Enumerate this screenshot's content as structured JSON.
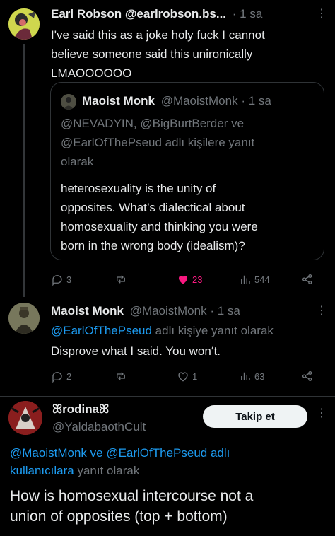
{
  "tweet1": {
    "display_name": "Earl Robson @earlrobson.bs...",
    "dot": "·",
    "time": "1 sa",
    "text_line1": "I've said this as a joke holy fuck I cannot",
    "text_line2": "believe someone said this unironically",
    "text_line3": "LMAOOOOOO",
    "quote": {
      "display_name": "Maoist Monk",
      "handle": "@MaoistMonk",
      "dot": "·",
      "time": "1 sa",
      "reply_line1": "@NEVADYIN, @BigBurtBerder ve",
      "reply_line2_handle": "@EarlOfThePseud",
      "reply_line2_rest": " adlı kişilere yanıt",
      "reply_line3": "olarak",
      "body_line1": "heterosexuality is the unity of",
      "body_line2": "opposites. What’s dialectical about",
      "body_line3": "homosexuality and thinking you were",
      "body_line4": "born in the wrong body (idealism)?"
    },
    "stats": {
      "replies": "3",
      "likes": "23",
      "views": "544"
    }
  },
  "tweet2": {
    "display_name": "Maoist Monk",
    "handle": "@MaoistMonk",
    "dot": "·",
    "time": "1 sa",
    "reply_handle": "@EarlOfThePseud",
    "reply_rest": " adlı kişiye yanıt olarak",
    "text": "Disprove what I said. You won‘t.",
    "stats": {
      "replies": "2",
      "likes": "1",
      "views": "63"
    }
  },
  "tweet3": {
    "display_name": "ꕤrodinaꕤ",
    "handle": "@YaldabaothCult",
    "follow_label": "Takip et",
    "reply_line1_a": "@MaoistMonk",
    "reply_line1_b": " ve ",
    "reply_line1_c": "@EarlOfThePseud adlı",
    "reply_line2_a": "kullanıcılara",
    "reply_line2_b": " yanıt olarak",
    "text_line1": "How is homosexual intercourse not a",
    "text_line2": "union of opposites (top + bottom)"
  },
  "colors": {
    "background": "#000000",
    "link": "#1d9bf0",
    "like": "#f91880",
    "muted": "#71767b"
  }
}
